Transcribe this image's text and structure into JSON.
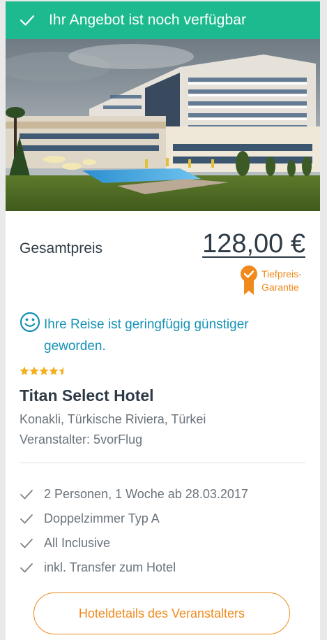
{
  "banner": {
    "text": "Ihr Angebot ist noch verfügbar",
    "color": "#1dba8f",
    "icon": "checkmark-icon"
  },
  "hero": {
    "image": "hotel-photo"
  },
  "price": {
    "label": "Gesamtpreis",
    "value": "128,00 €"
  },
  "guarantee": {
    "line1": "Tiefpreis-",
    "line2": "Garantie",
    "icon": "ribbon-check-icon",
    "color": "#f08a1c"
  },
  "notice": {
    "text": "Ihre Reise ist geringfügig günstiger geworden.",
    "icon": "smiley-icon",
    "color": "#1591b5"
  },
  "hotel": {
    "stars": 4.5,
    "name": "Titan Select Hotel",
    "location": "Konakli, Türkische Riviera, Türkei",
    "operator": "Veranstalter: 5vorFlug"
  },
  "features": [
    {
      "text": "2 Personen, 1 Woche ab 28.03.2017",
      "icon": "check-icon"
    },
    {
      "text": "Doppelzimmer Typ A",
      "icon": "check-icon"
    },
    {
      "text": "All Inclusive",
      "icon": "check-icon"
    },
    {
      "text": "inkl. Transfer zum Hotel",
      "icon": "check-icon"
    }
  ],
  "details_button": {
    "label": "Hoteldetails des Veranstalters"
  },
  "colors": {
    "accent": "#f08a1c",
    "brand": "#1dba8f",
    "text": "#2e3b46",
    "muted": "#6a737b",
    "star": "#f2b01e"
  }
}
